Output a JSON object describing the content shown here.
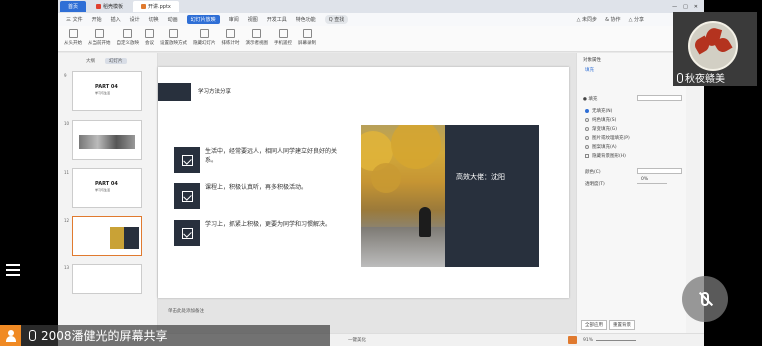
{
  "tabs": [
    {
      "label": "首页",
      "kind": "home"
    },
    {
      "label": "稻壳模板",
      "kind": "doc"
    },
    {
      "label": "开讲.pptx",
      "kind": "active"
    }
  ],
  "menu": {
    "file": "三 文件",
    "items": [
      "开始",
      "插入",
      "设计",
      "切换",
      "动画",
      "幻灯片放映",
      "审阅",
      "视图",
      "开发工具",
      "特色功能"
    ],
    "active_index": 5,
    "search": "Q 查找",
    "right": [
      "△ 未同步",
      "& 协作",
      "△ 分享"
    ]
  },
  "toolbar": [
    "从头开始",
    "从当前开始",
    "自定义放映",
    "会议",
    "设置放映方式",
    "隐藏幻灯片",
    "排练计时",
    "演示者视图",
    "手机遥控",
    "屏幕录制"
  ],
  "left_panel": {
    "tabs": [
      "大纲",
      "幻灯片"
    ],
    "thumbs": [
      {
        "num": "9",
        "title": "PART 04",
        "subtitle": "学习与生活"
      },
      {
        "num": "10",
        "title": "",
        "subtitle": ""
      },
      {
        "num": "11",
        "title": "PART 04",
        "subtitle": "学习与生活"
      },
      {
        "num": "12",
        "title": "",
        "subtitle": ""
      },
      {
        "num": "13",
        "title": "",
        "subtitle": ""
      }
    ]
  },
  "slide": {
    "title": "学习方法分享",
    "items": [
      "生活中，经常要远人，相同人同学建立好良好的关系。",
      "课程上，积极认真听，再多积极活动。",
      "学习上，抓紧上积极，更要为同学和习惯解决。"
    ],
    "caption": "高效大佬：沈阳"
  },
  "notes": "单击此处添加备注",
  "right_panel": {
    "title": "对象属性",
    "section": "填充",
    "fill_label": "● 填充",
    "options": [
      "无填充(N)",
      "纯色填充(S)",
      "渐变填充(G)",
      "图片或纹理填充(P)",
      "图案填充(A)",
      "隐藏背景图形(H)"
    ],
    "selected_option": 0,
    "color_label": "颜色(C)",
    "transparency_label": "透明度(T)",
    "transparency_value": "0%",
    "buttons": [
      "全部应用",
      "重置背景"
    ]
  },
  "statusbar": {
    "beautify": "一键美化",
    "zoom": "91%"
  },
  "meeting": {
    "participant_name": "秋夜赣美",
    "share_label": "2008潘健光的屏幕共享"
  },
  "colors": {
    "accent": "#2f6fd6",
    "slide_dark": "#28303d",
    "share_orange": "#f08a24"
  }
}
